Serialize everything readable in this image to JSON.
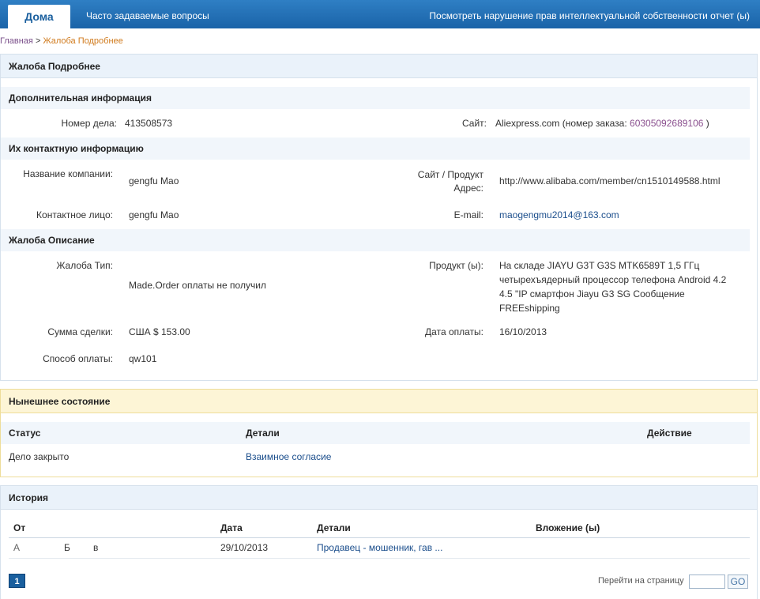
{
  "nav": {
    "home": "Дома",
    "faq": "Часто задаваемые вопросы",
    "ipr_report": "Посмотреть нарушение прав интеллектуальной собственности отчет (ы)"
  },
  "breadcrumb": {
    "home": "Главная",
    "separator": ">",
    "current": "Жалоба Подробнее"
  },
  "detail": {
    "title": "Жалоба Подробнее",
    "additional": {
      "heading": "Дополнительная информация",
      "case_label": "Номер дела:",
      "case_value": "413508573",
      "site_label": "Сайт:",
      "site_value": "Aliexpress.com (номер заказа:",
      "order_number": "60305092689106",
      "site_close": ")"
    },
    "contact": {
      "heading": "Их контактную информацию",
      "company_label": "Название компании:",
      "company_value": "gengfu Mao",
      "site_product_label_1": "Сайт / Продукт",
      "site_product_label_2": "Адрес:",
      "site_product_value": "http://www.alibaba.com/member/cn1510149588.html",
      "person_label": "Контактное лицо:",
      "person_value": "gengfu Mao",
      "email_label": "E-mail:",
      "email_value": "maogengmu2014@163.com"
    },
    "complaint": {
      "heading": "Жалоба Описание",
      "type_label": "Жалоба Тип:",
      "type_value": "Made.Order оплаты не получил",
      "product_label": "Продукт (ы):",
      "product_lines": [
        "На складе JIAYU G3T G3S MTK6589T 1,5 ГГц",
        "четырехъядерный процессор телефона Android 4.2",
        "4.5 \"IP смартфон Jiayu G3 SG Сообщение",
        "FREEshipping"
      ],
      "amount_label": "Сумма сделки:",
      "amount_value": "США $ 153.00",
      "paydate_label": "Дата оплаты:",
      "paydate_value": "16/10/2013",
      "method_label": "Способ оплаты:",
      "method_value": "qw101"
    }
  },
  "status": {
    "title": "Нынешнее состояние",
    "col_status": "Статус",
    "col_details": "Детали",
    "col_action": "Действие",
    "row_status": "Дело закрыто",
    "row_details": "Взаимное согласие"
  },
  "history": {
    "title": "История",
    "col_from": "От",
    "col_date": "Дата",
    "col_details": "Детали",
    "col_attachment": "Вложение (ы)",
    "row": {
      "from_a": "А",
      "from_b": "Б",
      "from_c": "в",
      "date": "29/10/2013",
      "details": "Продавец - мошенник, гав ..."
    },
    "page_current": "1",
    "goto_label": "Перейти на страницу",
    "go": "GO"
  },
  "colors": {
    "nav_blue": "#1a63a8",
    "link_blue": "#1b4e8c",
    "link_purple": "#8a4f8e",
    "crumb_orange": "#d07a1c",
    "status_yellow": "#fdf5d6"
  }
}
